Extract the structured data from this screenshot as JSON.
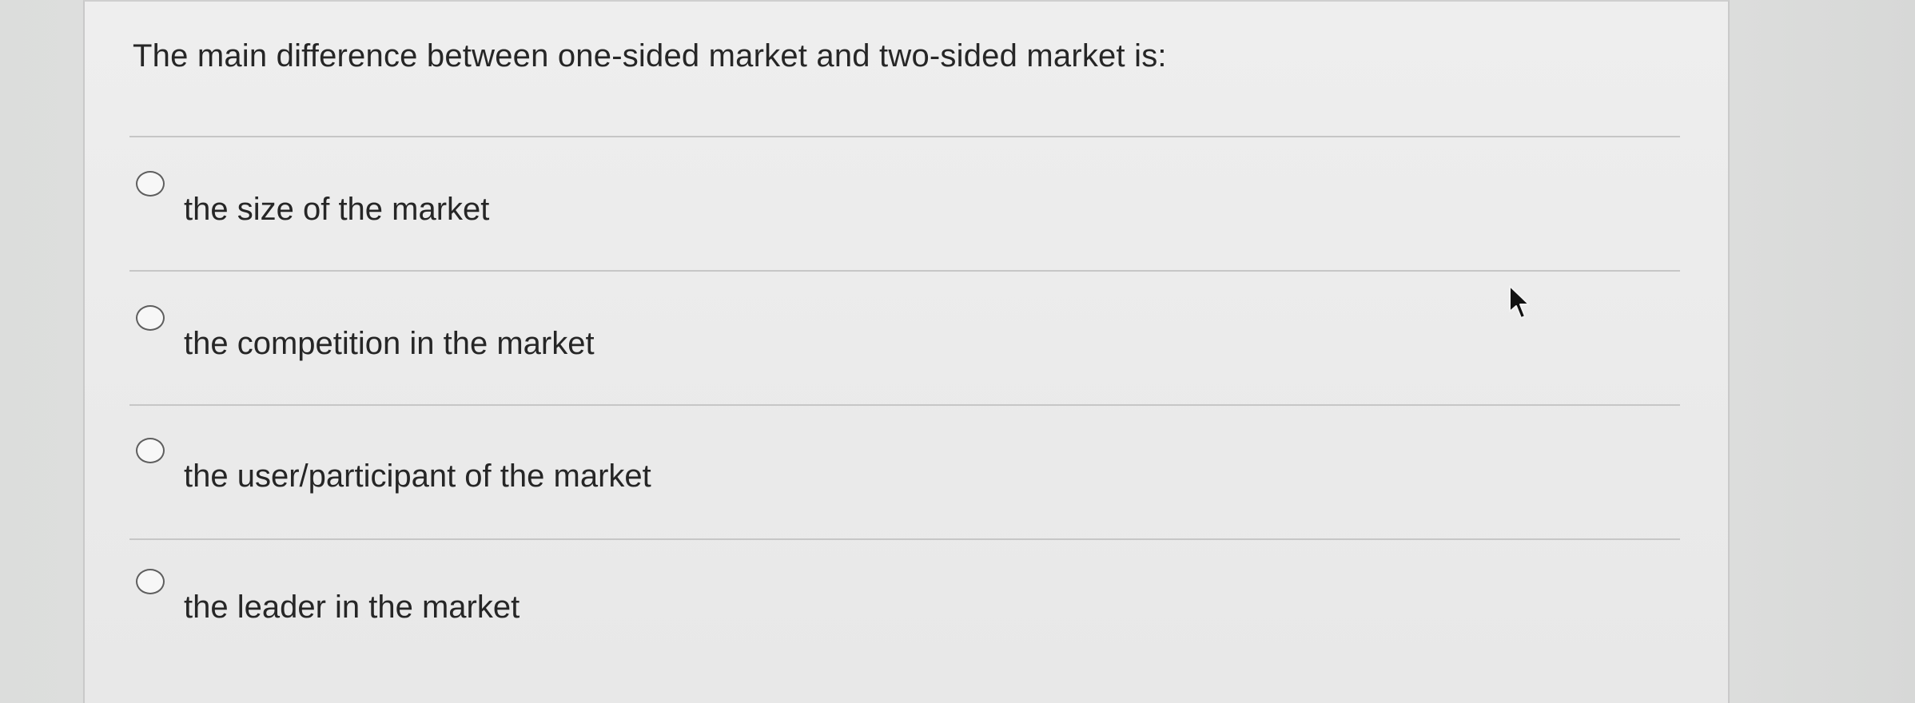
{
  "question": {
    "text": "The main difference between one-sided market and two-sided market is:"
  },
  "options": [
    {
      "label": "the size of the market",
      "selected": false
    },
    {
      "label": "the competition in the market",
      "selected": false
    },
    {
      "label": "the user/participant of the market",
      "selected": false
    },
    {
      "label": "the leader in the market",
      "selected": false
    }
  ],
  "icons": {
    "cursor": "mouse-pointer-icon"
  },
  "colors": {
    "text": "#262626",
    "card_background": "#eeeeee",
    "divider": "#c6c6c6",
    "radio_border": "#5e5e5e"
  }
}
